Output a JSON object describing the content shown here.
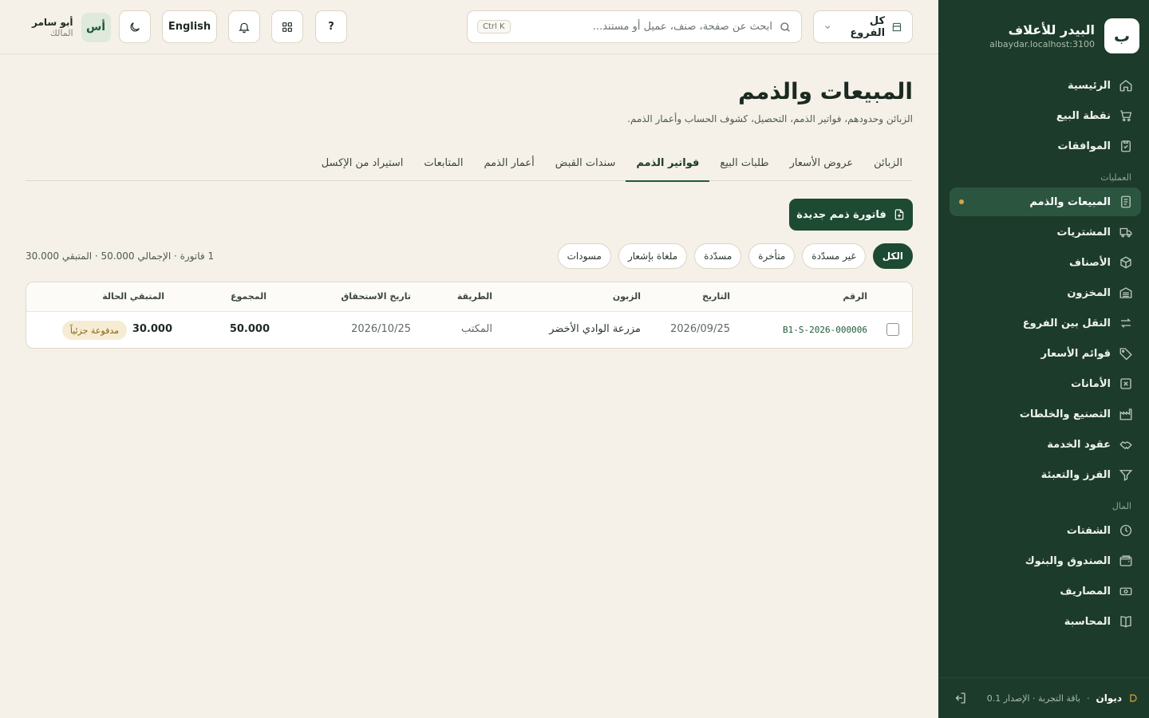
{
  "brand": {
    "logo_letter": "ب",
    "name": "البيدر للأعلاف",
    "host": "albaydar.localhost:3100"
  },
  "sidebar": {
    "items_top": [
      {
        "label": "الرئيسية",
        "icon": "home-icon"
      },
      {
        "label": "نقطة البيع",
        "icon": "cart-icon"
      },
      {
        "label": "الموافقات",
        "icon": "clipboard-check-icon"
      }
    ],
    "section_ops": "العمليات",
    "items_ops": [
      {
        "label": "المبيعات والذمم",
        "icon": "receipt-icon",
        "active": true
      },
      {
        "label": "المشتريات",
        "icon": "truck-icon"
      },
      {
        "label": "الأصناف",
        "icon": "box-icon"
      },
      {
        "label": "المخزون",
        "icon": "warehouse-icon"
      },
      {
        "label": "النقل بين الفروع",
        "icon": "transfer-icon"
      },
      {
        "label": "قوائم الأسعار",
        "icon": "tag-icon"
      },
      {
        "label": "الأمانات",
        "icon": "x-square-icon"
      },
      {
        "label": "التصنيع والخلطات",
        "icon": "factory-icon"
      },
      {
        "label": "عقود الخدمة",
        "icon": "handshake-icon"
      },
      {
        "label": "الفرز والتعبئة",
        "icon": "filter-icon"
      }
    ],
    "section_money": "المال",
    "items_money": [
      {
        "label": "الشفتات",
        "icon": "clock-icon"
      },
      {
        "label": "الصندوق والبنوك",
        "icon": "wallet-icon"
      },
      {
        "label": "المصاريف",
        "icon": "banknote-icon"
      },
      {
        "label": "المحاسبة",
        "icon": "book-icon"
      }
    ],
    "footer": {
      "app": "ديوان",
      "sep": "·",
      "plan": "باقة التجربة · الإصدار 0.1"
    }
  },
  "topbar": {
    "branch": "كل الفروع",
    "search_placeholder": "ابحث عن صفحة، صنف، عميل أو مستند...",
    "shortcut": "Ctrl K",
    "help": "?",
    "language": "English",
    "user": {
      "initials": "أس",
      "name": "أبو سامر",
      "role": "المالك"
    }
  },
  "page": {
    "title": "المبيعات والذمم",
    "subtitle": "الزبائن وحدودهم، فواتير الذمم، التحصيل، كشوف الحساب وأعمار الذمم.",
    "tabs": [
      "الزبائن",
      "عروض الأسعار",
      "طلبات البيع",
      "فواتير الذمم",
      "سندات القبض",
      "أعمار الذمم",
      "المتابعات",
      "استيراد من الإكسل"
    ],
    "active_tab": "فواتير الذمم",
    "new_button": "فاتورة ذمم جديدة",
    "filters": [
      "الكل",
      "غير مسدّدة",
      "متأخرة",
      "مسدّدة",
      "ملغاة بإشعار",
      "مسودات"
    ],
    "active_filter": "الكل",
    "summary": "1 فاتورة · الإجمالي 50.000 · المتبقي 30.000",
    "table": {
      "headers": {
        "number": "الرقم",
        "date": "التاريخ",
        "customer": "الزبون",
        "method": "الطريقة",
        "due": "تاريخ الاستحقاق",
        "total": "المجموع",
        "remaining": "المتبقي",
        "status": "الحالة"
      },
      "rows": [
        {
          "number": "B1-S-2026-000006",
          "date": "2026/09/25",
          "customer": "مزرعة الوادي الأخضر",
          "method": "المكتب",
          "due": "2026/10/25",
          "total": "50.000",
          "remaining": "30.000",
          "status": "مدفوعة جزئياً"
        }
      ]
    }
  }
}
